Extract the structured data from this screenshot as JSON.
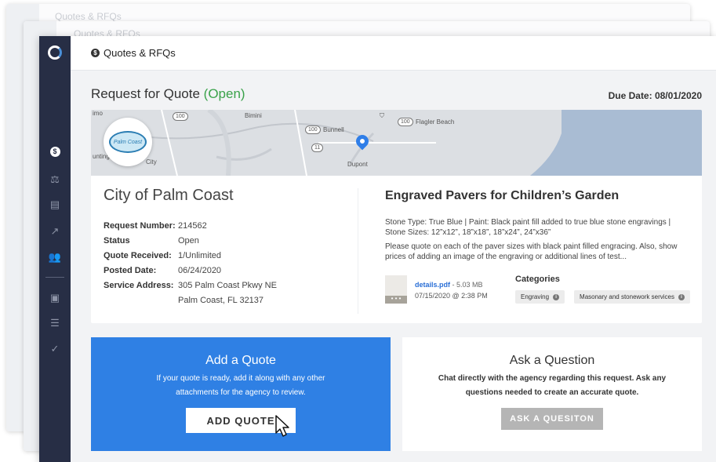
{
  "background_windows": [
    {
      "title": "Quotes & RFQs"
    },
    {
      "title": "Quotes & RFQs"
    }
  ],
  "topbar": {
    "title": "Quotes & RFQs"
  },
  "page": {
    "title": "Request for Quote",
    "status": "(Open)",
    "due_date": "Due Date: 08/01/2020"
  },
  "map": {
    "labels": {
      "left": "imo",
      "bimini": "Bimini",
      "bunnell": "Bunnell",
      "flagler": "Flagler Beach",
      "dupont": "Dupont",
      "hunting": "unting",
      "city": "City"
    },
    "routes": {
      "r100a": "100",
      "r100b": "100",
      "r11": "11",
      "r100c": "100"
    },
    "seal_text": "Palm Coast"
  },
  "org": {
    "name": "City of Palm Coast"
  },
  "info": [
    {
      "key": "Request Number:",
      "value": "214562"
    },
    {
      "key": "Status",
      "value": "Open"
    },
    {
      "key": "Quote Received:",
      "value": "1/Unlimited"
    },
    {
      "key": "Posted Date:",
      "value": "06/24/2020"
    },
    {
      "key": "Service Address:",
      "value": "305 Palm Coast Pkwy NE"
    },
    {
      "key": "",
      "value": "Palm Coast, FL 32137"
    }
  ],
  "rfq": {
    "title": "Engraved Pavers for Children’s Garden",
    "desc1": "Stone Type: True Blue  | Paint: Black paint fill added to true blue stone engravings  | Stone Sizes: 12”x12”, 18”x18”, 18”x24”, 24”x36”",
    "desc2": "Please quote on each of the paver sizes with black paint filled engracing. Also, show prices of adding an image of the engraving or additional lines of test...",
    "file_name": "details.pdf",
    "file_size": " - 5.03 MB",
    "file_date": "07/15/2020 @ 2:38 PM",
    "categories_label": "Categories",
    "categories": [
      "Engraving",
      "Masonary and stonework services"
    ]
  },
  "add_quote": {
    "heading": "Add a Quote",
    "text": "If your quote is ready, add it along with any other attachments for the agency to review.",
    "button": "ADD QUOTE"
  },
  "ask_question": {
    "heading": "Ask a Question",
    "text": "Chat directly with the agency regarding this request. Ask any questions needed to create an accurate quote.",
    "button": "ASK A QUESITON"
  },
  "colors": {
    "accent": "#2f80e4",
    "open_status": "#3aa24a",
    "sidebar": "#272e45"
  }
}
